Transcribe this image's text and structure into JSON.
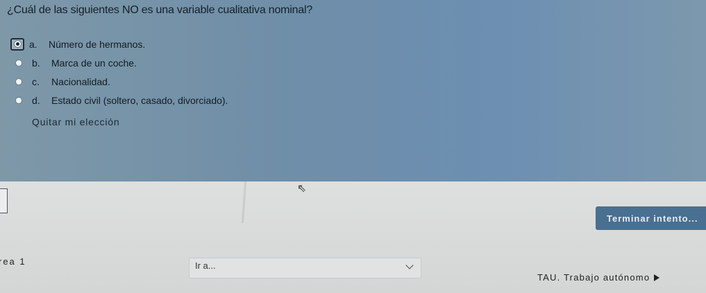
{
  "question": {
    "text": "¿Cuál de las siguientes NO es una variable cualitativa nominal?",
    "options": [
      {
        "letter": "a.",
        "text": "Número de hermanos.",
        "selected": true
      },
      {
        "letter": "b.",
        "text": "Marca de un coche.",
        "selected": false
      },
      {
        "letter": "c.",
        "text": "Nacionalidad.",
        "selected": false
      },
      {
        "letter": "d.",
        "text": "Estado civil (soltero, casado, divorciado).",
        "selected": false
      }
    ],
    "clear_choice": "Quitar mi elección"
  },
  "navigation": {
    "finish_button": "Terminar intento...",
    "prev_activity": "rea 1",
    "jump_select": "Ir a...",
    "next_activity": "TAU. Trabajo autónomo"
  },
  "colors": {
    "question_panel": "#6f8ea8",
    "finish_button": "#496f91"
  },
  "icons": [
    "radio-selected-icon",
    "radio-icon",
    "chevron-down-icon",
    "play-icon",
    "mouse-cursor-icon"
  ]
}
